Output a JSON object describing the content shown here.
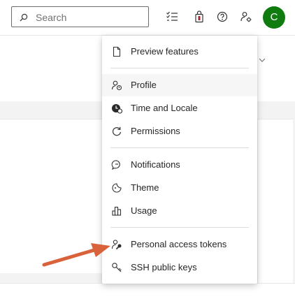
{
  "header": {
    "search": {
      "placeholder": "Search",
      "value": ""
    },
    "icons": [
      "task-list-icon",
      "shopping-bag-icon",
      "help-icon",
      "user-settings-icon"
    ],
    "avatar": {
      "initial": "C",
      "color": "#107c10"
    }
  },
  "menu": {
    "items": [
      {
        "label": "Preview features",
        "icon": "document-icon"
      },
      {
        "label": "Profile",
        "icon": "profile-icon"
      },
      {
        "label": "Time and Locale",
        "icon": "clock-globe-icon"
      },
      {
        "label": "Permissions",
        "icon": "refresh-icon"
      },
      {
        "label": "Notifications",
        "icon": "chat-bubble-icon"
      },
      {
        "label": "Theme",
        "icon": "theme-icon"
      },
      {
        "label": "Usage",
        "icon": "bar-chart-icon"
      },
      {
        "label": "Personal access tokens",
        "icon": "person-key-icon"
      },
      {
        "label": "SSH public keys",
        "icon": "key-icon"
      }
    ],
    "hovered": "Profile"
  },
  "annotation": {
    "arrow_color": "#d9623b"
  }
}
